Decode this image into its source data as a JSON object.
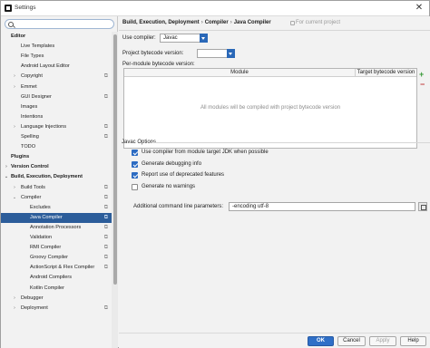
{
  "window": {
    "title": "Settings",
    "close_glyph": "✕"
  },
  "search": {
    "placeholder": ""
  },
  "tree": [
    {
      "label": "Editor",
      "bold": true,
      "indent": 0,
      "arrow": "",
      "cog": false,
      "selected": false
    },
    {
      "label": "Live Templates",
      "bold": false,
      "indent": 2,
      "arrow": "",
      "cog": false,
      "selected": false
    },
    {
      "label": "File Types",
      "bold": false,
      "indent": 2,
      "arrow": "",
      "cog": false,
      "selected": false
    },
    {
      "label": "Android Layout Editor",
      "bold": false,
      "indent": 2,
      "arrow": "",
      "cog": false,
      "selected": false
    },
    {
      "label": "Copyright",
      "bold": false,
      "indent": 2,
      "arrow": "›",
      "cog": true,
      "selected": false
    },
    {
      "label": "Emmet",
      "bold": false,
      "indent": 2,
      "arrow": "›",
      "cog": false,
      "selected": false
    },
    {
      "label": "GUI Designer",
      "bold": false,
      "indent": 2,
      "arrow": "",
      "cog": true,
      "selected": false
    },
    {
      "label": "Images",
      "bold": false,
      "indent": 2,
      "arrow": "",
      "cog": false,
      "selected": false
    },
    {
      "label": "Intentions",
      "bold": false,
      "indent": 2,
      "arrow": "",
      "cog": false,
      "selected": false
    },
    {
      "label": "Language Injections",
      "bold": false,
      "indent": 2,
      "arrow": "›",
      "cog": true,
      "selected": false
    },
    {
      "label": "Spelling",
      "bold": false,
      "indent": 2,
      "arrow": "",
      "cog": true,
      "selected": false
    },
    {
      "label": "TODO",
      "bold": false,
      "indent": 2,
      "arrow": "",
      "cog": false,
      "selected": false
    },
    {
      "label": "Plugins",
      "bold": true,
      "indent": 0,
      "arrow": "",
      "cog": false,
      "selected": false
    },
    {
      "label": "Version Control",
      "bold": true,
      "indent": 0,
      "arrow": "›",
      "cog": false,
      "selected": false
    },
    {
      "label": "Build, Execution, Deployment",
      "bold": true,
      "indent": 0,
      "arrow": "⌄",
      "cog": false,
      "selected": false
    },
    {
      "label": "Build Tools",
      "bold": false,
      "indent": 2,
      "arrow": "›",
      "cog": true,
      "selected": false
    },
    {
      "label": "Compiler",
      "bold": false,
      "indent": 2,
      "arrow": "⌄",
      "cog": true,
      "selected": false
    },
    {
      "label": "Excludes",
      "bold": false,
      "indent": 3,
      "arrow": "",
      "cog": true,
      "selected": false
    },
    {
      "label": "Java Compiler",
      "bold": false,
      "indent": 3,
      "arrow": "",
      "cog": true,
      "selected": true
    },
    {
      "label": "Annotation Processors",
      "bold": false,
      "indent": 3,
      "arrow": "",
      "cog": true,
      "selected": false
    },
    {
      "label": "Validation",
      "bold": false,
      "indent": 3,
      "arrow": "",
      "cog": true,
      "selected": false
    },
    {
      "label": "RMI Compiler",
      "bold": false,
      "indent": 3,
      "arrow": "",
      "cog": true,
      "selected": false
    },
    {
      "label": "Groovy Compiler",
      "bold": false,
      "indent": 3,
      "arrow": "",
      "cog": true,
      "selected": false
    },
    {
      "label": "ActionScript & Flex Compiler",
      "bold": false,
      "indent": 3,
      "arrow": "",
      "cog": true,
      "selected": false
    },
    {
      "label": "Android Compilers",
      "bold": false,
      "indent": 3,
      "arrow": "",
      "cog": false,
      "selected": false
    },
    {
      "label": "Kotlin Compiler",
      "bold": false,
      "indent": 3,
      "arrow": "",
      "cog": false,
      "selected": false
    },
    {
      "label": "Debugger",
      "bold": false,
      "indent": 2,
      "arrow": "›",
      "cog": false,
      "selected": false
    },
    {
      "label": "Deployment",
      "bold": false,
      "indent": 2,
      "arrow": "›",
      "cog": true,
      "selected": false
    }
  ],
  "breadcrumb": [
    "Build, Execution, Deployment",
    "Compiler",
    "Java Compiler"
  ],
  "breadcrumb_sep": "›",
  "breadcrumb_hint": "For current project",
  "use_compiler": {
    "label": "Use compiler:",
    "value": "Javac"
  },
  "bytecode_version": {
    "label": "Project bytecode version:",
    "value": ""
  },
  "per_module": {
    "label": "Per-module bytecode version:",
    "columns": [
      "Module",
      "Target bytecode version"
    ],
    "empty_text": "All modules will be compiled with project bytecode version",
    "add_glyph": "+",
    "remove_glyph": "−"
  },
  "javac_options": {
    "section_label": "Javac Options",
    "checkboxes": [
      {
        "label": "Use compiler from module target JDK when possible",
        "checked": true
      },
      {
        "label": "Generate debugging info",
        "checked": true
      },
      {
        "label": "Report use of deprecated features",
        "checked": true
      },
      {
        "label": "Generate no warnings",
        "checked": false
      }
    ],
    "additional_params": {
      "label": "Additional command line parameters:",
      "value": "-encoding utf-8"
    }
  },
  "buttons": {
    "ok": "OK",
    "cancel": "Cancel",
    "apply": "Apply",
    "help": "Help"
  },
  "colors": {
    "accent": "#2f6fc7",
    "selection": "#2c5d9a"
  }
}
